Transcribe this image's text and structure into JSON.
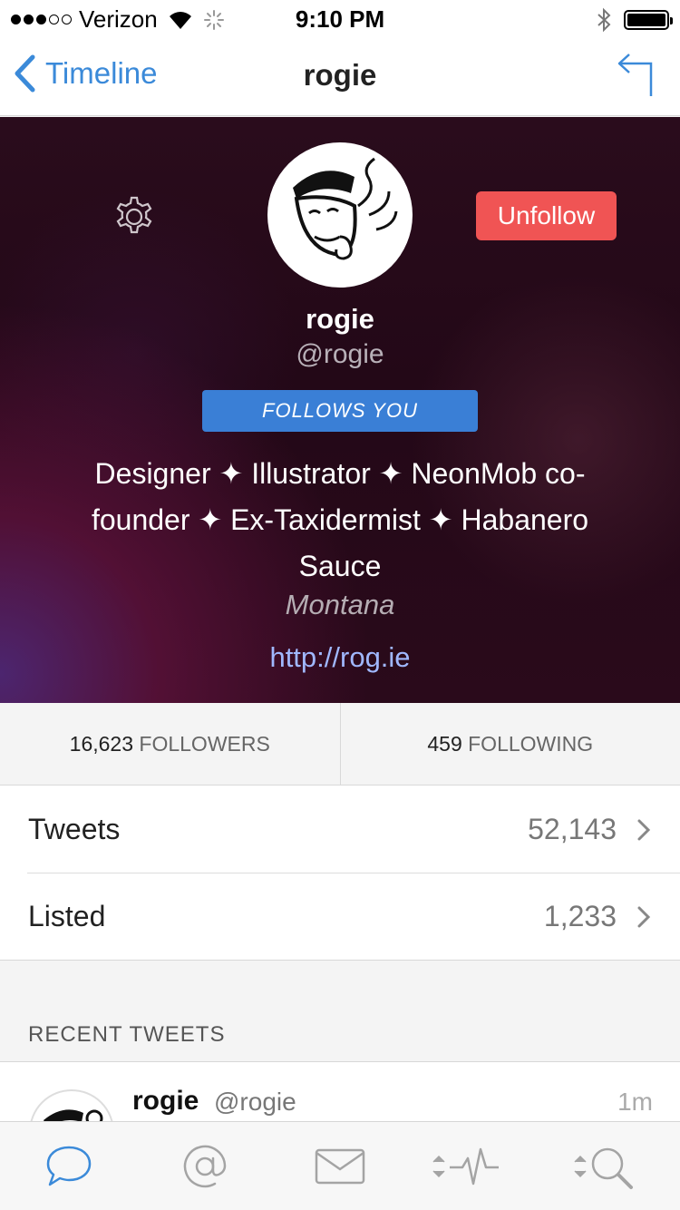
{
  "status_bar": {
    "carrier": "Verizon",
    "time": "9:10 PM"
  },
  "nav": {
    "back_label": "Timeline",
    "title": "rogie"
  },
  "profile": {
    "unfollow_label": "Unfollow",
    "name": "rogie",
    "handle": "@rogie",
    "follows_you_label": "FOLLOWS YOU",
    "bio": "Designer ✦ Illustrator ✦ NeonMob co-founder ✦ Ex-Taxidermist ✦ Habanero Sauce",
    "location": "Montana",
    "url": "http://rog.ie"
  },
  "stats": {
    "followers_count": "16,623",
    "followers_label": "FOLLOWERS",
    "following_count": "459",
    "following_label": "FOLLOWING"
  },
  "list": [
    {
      "label": "Tweets",
      "value": "52,143"
    },
    {
      "label": "Listed",
      "value": "1,233"
    }
  ],
  "recent_tweets": {
    "section_title": "RECENT TWEETS",
    "items": [
      {
        "name": "rogie",
        "handle": "@rogie",
        "time": "1m"
      }
    ]
  },
  "tabs": [
    {
      "name": "timeline-tab",
      "icon": "speech-bubble-icon",
      "active": true
    },
    {
      "name": "mentions-tab",
      "icon": "at-sign-icon",
      "active": false
    },
    {
      "name": "messages-tab",
      "icon": "envelope-icon",
      "active": false
    },
    {
      "name": "activity-tab",
      "icon": "activity-pulse-icon",
      "active": false
    },
    {
      "name": "search-tab",
      "icon": "search-icon",
      "active": false
    }
  ],
  "colors": {
    "accent": "#3b8ad9",
    "unfollow": "#f05454",
    "badge": "#3a7fd6",
    "link": "#a0b8ff"
  }
}
